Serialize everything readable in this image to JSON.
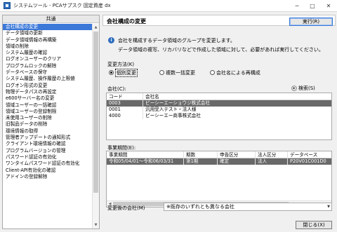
{
  "window": {
    "title": "システムツール - PCAサプスク 固定資産 dx",
    "minimize": "─",
    "maximize": "□",
    "close": "✕"
  },
  "sidebar": {
    "header": "共通",
    "items": [
      "会社構成の変更",
      "データ領域の更新",
      "データ領域情報の再構築",
      "領域の削除",
      "システム履歴の確認",
      "ログオンユーザーのクリア",
      "プログラムロックの解除",
      "データベースの保守",
      "システム履歴、操作履歴の上限値",
      "ログオン形式の変更",
      "物理データパスの再設定",
      "e600サーバー名の変更",
      "領域ユーザーの一括確認",
      "領域ユーザーの登録制限",
      "未使用ユーザーの削除",
      "旧製品データの削除",
      "環境情報の取得",
      "管理者アップデートの通知形式",
      "クライアント環境情報の確認",
      "プログラムバージョンの管理",
      "パスワード認証の有効化",
      "ワンタイムパスワード認証の有効化",
      "Client-API有効化の確認",
      "アドインの登録解除"
    ]
  },
  "main": {
    "title": "会社構成の変更",
    "execute_button": "実行(R)",
    "info_line1": "会社を構成するデータ領域のグループを変更します。",
    "info_line2": "データ領域の複写、リカバリなどで作成した領域に対して、必要があれば実行してください。",
    "change_method_label": "変更方法(K)",
    "radio_options": [
      {
        "label": "個別変更",
        "checked": true
      },
      {
        "label": "複数一括変更",
        "checked": false
      },
      {
        "label": "会社名による再構成",
        "checked": false
      }
    ],
    "company_label": "会社(C):",
    "search_label": "検索(S)",
    "company_grid": {
      "columns": [
        "コード",
        "会社名"
      ],
      "rows": [
        {
          "code": "0003",
          "name": "ピーシーエーショウジ株式会社",
          "selected": true
        },
        {
          "code": "0001",
          "name": "汎用受入テスト・法人様",
          "selected": false
        },
        {
          "code": "4000",
          "name": "ピーシーエー商事株式会社",
          "selected": false
        }
      ]
    },
    "period_label": "事業期間(E):",
    "period_grid": {
      "columns": [
        "事業期間",
        "期数",
        "申告区分",
        "法人区分",
        "データベース"
      ],
      "rows": [
        {
          "period": "令和05/04/01～令和06/03/31",
          "term": "第1期",
          "filing": "確定",
          "corp": "法人",
          "db": "P20V01C001D0",
          "selected": true
        }
      ]
    },
    "after_change_label": "変更後の会社(M)",
    "after_change_value": "※既存のいずれとも異なる会社",
    "close_button": "閉じる(X)"
  },
  "colors": {
    "selection_blue": "#3b78d8",
    "grid_selection": "#696969",
    "info_blue": "#2f6fbf"
  }
}
